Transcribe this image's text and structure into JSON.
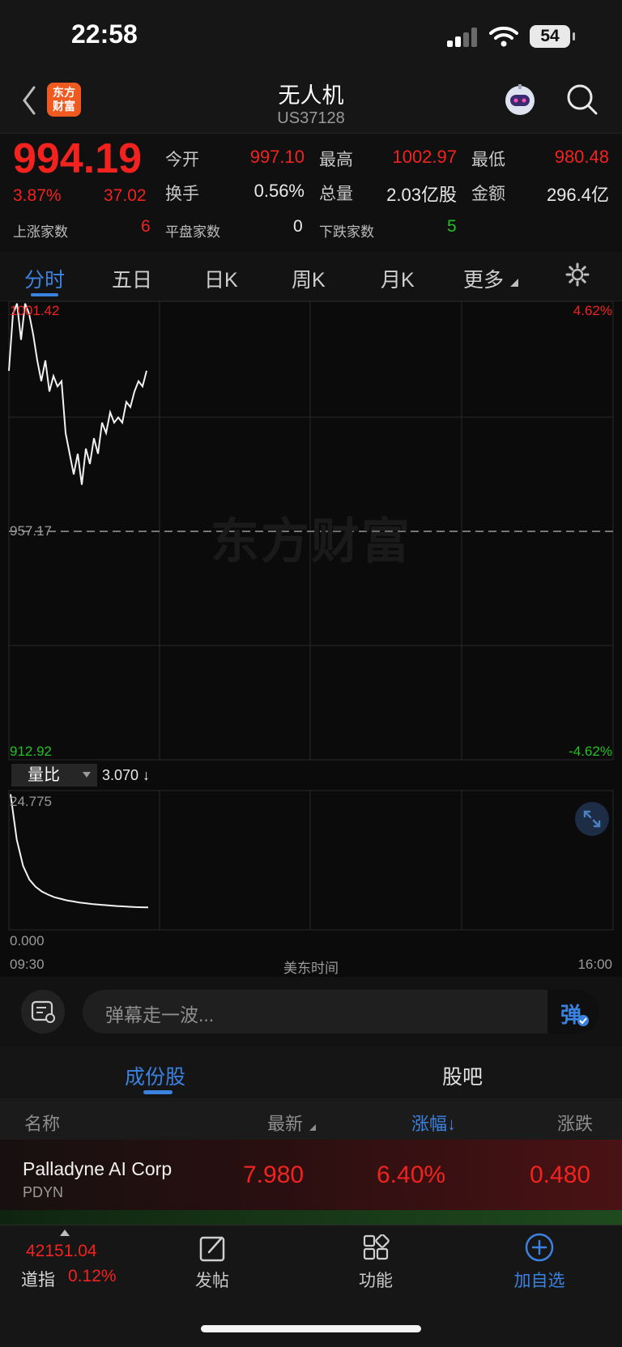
{
  "status_bar": {
    "time": "22:58",
    "battery": "54"
  },
  "header": {
    "title": "无人机",
    "code": "US37128",
    "logo_text": "东方财富"
  },
  "quote": {
    "price": "994.19",
    "change_pct": "3.87%",
    "change": "37.02",
    "open_label": "今开",
    "open": "997.10",
    "high_label": "最高",
    "high": "1002.97",
    "low_label": "最低",
    "low": "980.48",
    "turnover_label": "换手",
    "turnover": "0.56%",
    "volume_label": "总量",
    "volume": "2.03亿股",
    "amount_label": "金额",
    "amount": "296.4亿",
    "up_label": "上涨家数",
    "up": "6",
    "flat_label": "平盘家数",
    "flat": "0",
    "down_label": "下跌家数",
    "down": "5"
  },
  "chart_tabs": [
    "分时",
    "五日",
    "日K",
    "周K",
    "月K",
    "更多"
  ],
  "chart": {
    "y_top": "1001.42",
    "y_mid": "957.17",
    "y_bottom": "912.92",
    "pct_top": "4.62%",
    "pct_bottom": "-4.62%",
    "watermark": "东方财富",
    "ratio_label": "量比",
    "ratio_value": "3.070 ↓",
    "ratio_top": "24.775",
    "ratio_bottom": "0.000",
    "time_start": "09:30",
    "time_mid": "美东时间",
    "time_end": "16:00"
  },
  "chart_data": [
    {
      "type": "line",
      "title": "",
      "xlabel": "美东时间",
      "x_range": [
        "09:30",
        "16:00"
      ],
      "ylim": [
        912.92,
        1001.42
      ],
      "reference": 957.17,
      "values": [
        988,
        999,
        1001,
        994,
        1001,
        999,
        995,
        990,
        986,
        990,
        984,
        987,
        985,
        986,
        976,
        972,
        968,
        972,
        966,
        973,
        970,
        975,
        972,
        978,
        976,
        980,
        978,
        979,
        978,
        982,
        981,
        984,
        986,
        985,
        988
      ]
    },
    {
      "type": "line",
      "title": "",
      "ylabel": "量比",
      "ylim": [
        0,
        24.775
      ],
      "values": [
        24.7,
        16,
        11,
        8.4,
        7,
        6.1,
        5.5,
        5.0,
        4.7,
        4.4,
        4.2,
        4.0,
        3.85,
        3.7,
        3.6,
        3.5,
        3.4,
        3.32,
        3.25,
        3.18,
        3.12,
        3.08,
        3.07
      ]
    }
  ],
  "comment": {
    "placeholder": "弹幕走一波...",
    "danmu": "弹"
  },
  "sub_tabs": [
    "成份股",
    "股吧"
  ],
  "table": {
    "headers": [
      "名称",
      "最新",
      "涨幅↓",
      "涨跌"
    ],
    "rows": [
      {
        "name": "Palladyne AI Corp",
        "code": "PDYN",
        "last": "7.980",
        "pct": "6.40%",
        "change": "0.480"
      }
    ]
  },
  "bottom_nav": {
    "index_value": "42151.04",
    "index_name": "道指",
    "index_pct": "0.12%",
    "post": "发帖",
    "func": "功能",
    "add": "加自选"
  },
  "colors": {
    "up": "#f2231f",
    "down": "#22c022",
    "accent": "#3b82e0"
  }
}
